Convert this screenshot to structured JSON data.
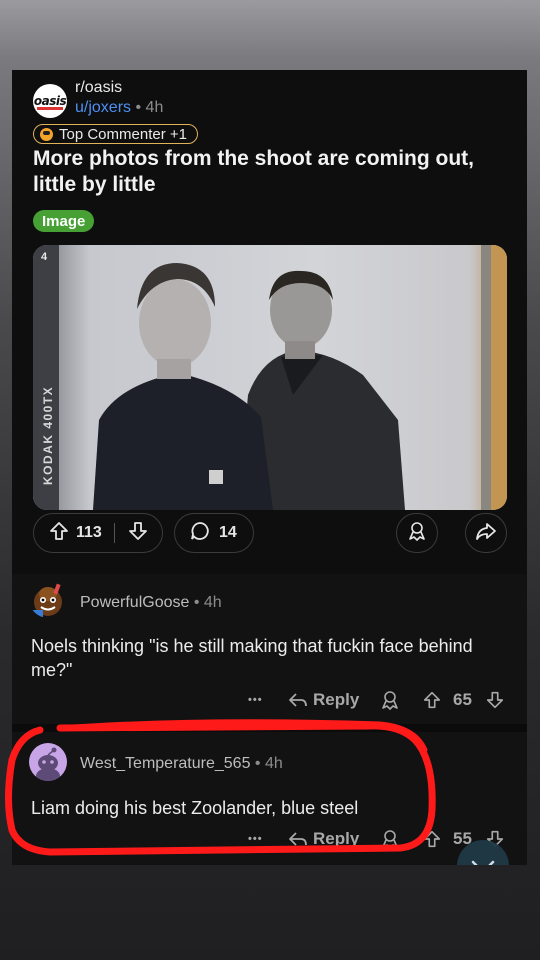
{
  "post": {
    "subreddit": "r/oasis",
    "subreddit_avatar_text": "oasis",
    "author": "u/joxers",
    "separator": "•",
    "age": "4h",
    "flair": "Top Commenter +1",
    "title": "More photos from the shoot are coming out, little by little",
    "tag": "Image",
    "film_number": "4",
    "film_label": "KODAK   400TX",
    "upvotes": "113",
    "comments": "14"
  },
  "comments": [
    {
      "author": "PowerfulGoose",
      "separator": "•",
      "age": "4h",
      "text": "Noels thinking \"is he still making that fuckin face behind me?\"",
      "more": "•••",
      "reply_label": "Reply",
      "votes": "65"
    },
    {
      "author": "West_Temperature_565",
      "separator": "•",
      "age": "4h",
      "text": "Liam doing his best Zoolander,  blue steel",
      "more": "•••",
      "reply_label": "Reply",
      "votes": "55"
    }
  ],
  "colors": {
    "link_blue": "#4e8ff2",
    "tag_green": "#46a034",
    "highlight_red": "#ff1a1a",
    "flair_border": "#e0b35a"
  },
  "icons": [
    "upvote-icon",
    "downvote-icon",
    "comment-icon",
    "award-icon",
    "share-icon",
    "reply-icon",
    "more-icon",
    "chevron-down-icon"
  ]
}
